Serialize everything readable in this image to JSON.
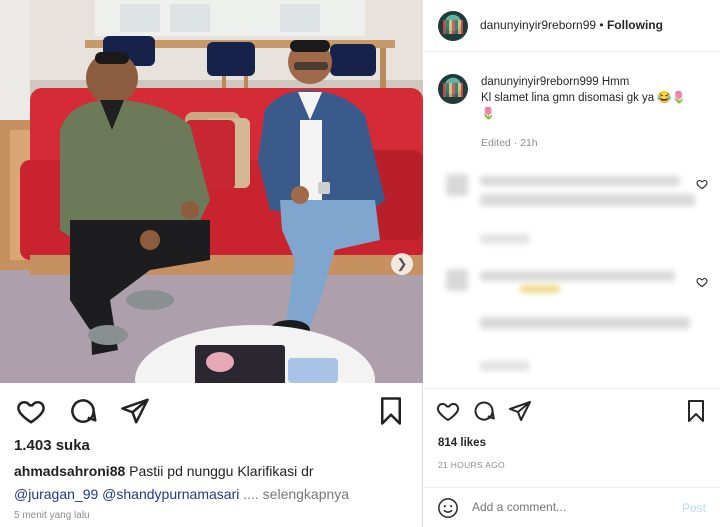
{
  "left_post": {
    "likes": "1.403 suka",
    "caption_user": "ahmadsahroni88",
    "caption_text": " Pastii pd nunggu Klarifikasi dr ",
    "mention_1": "@juragan_99",
    "mention_2": " @shandypurnamasari",
    "more": " .... selengkapnya",
    "time": "5 menit yang lalu",
    "icons": [
      "heart-icon",
      "comment-icon",
      "share-icon",
      "bookmark-icon",
      "chevron-right-icon"
    ]
  },
  "right_panel": {
    "header_username": "danunyinyir9reborn99",
    "header_dot": " • ",
    "header_follow": "Following",
    "caption_username": "danunyinyir9reborn999",
    "caption_text": " Hmm",
    "caption_line2": "Kl slamet lina gmn disomasi gk ya 😂🌷",
    "caption_line3": "🌷",
    "edited": "Edited · 21h",
    "likes": "814 likes",
    "time": "21 HOURS AGO",
    "comment_placeholder": "Add a comment...",
    "post_label": "Post"
  },
  "colors": {
    "sofa": "#d42b36",
    "jacket_green": "#6d7a5a",
    "blazer_blue": "#3a5a8c",
    "link_blue": "#1e3a8a",
    "post_disabled": "#b2dffc"
  }
}
